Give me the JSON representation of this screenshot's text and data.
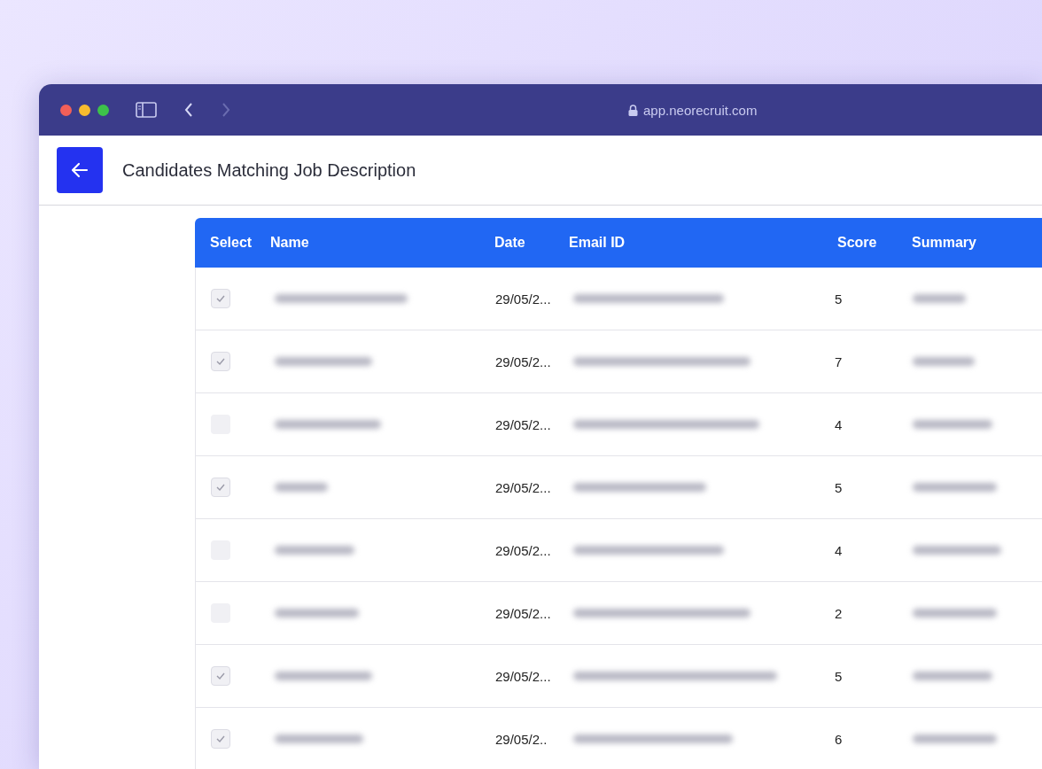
{
  "browser": {
    "url": "app.neorecruit.com"
  },
  "page": {
    "title": "Candidates Matching Job Description"
  },
  "table": {
    "columns": [
      "Select",
      "Name",
      "Date",
      "Email ID",
      "Score",
      "Summary"
    ],
    "rows": [
      {
        "checked": true,
        "date": "29/05/2...",
        "score": "5"
      },
      {
        "checked": true,
        "date": "29/05/2...",
        "score": "7"
      },
      {
        "checked": false,
        "date": "29/05/2...",
        "score": "4"
      },
      {
        "checked": true,
        "date": "29/05/2...",
        "score": "5"
      },
      {
        "checked": false,
        "date": "29/05/2...",
        "score": "4"
      },
      {
        "checked": false,
        "date": "29/05/2...",
        "score": "2"
      },
      {
        "checked": true,
        "date": "29/05/2...",
        "score": "5"
      },
      {
        "checked": true,
        "date": "29/05/2..",
        "score": "6"
      }
    ]
  }
}
